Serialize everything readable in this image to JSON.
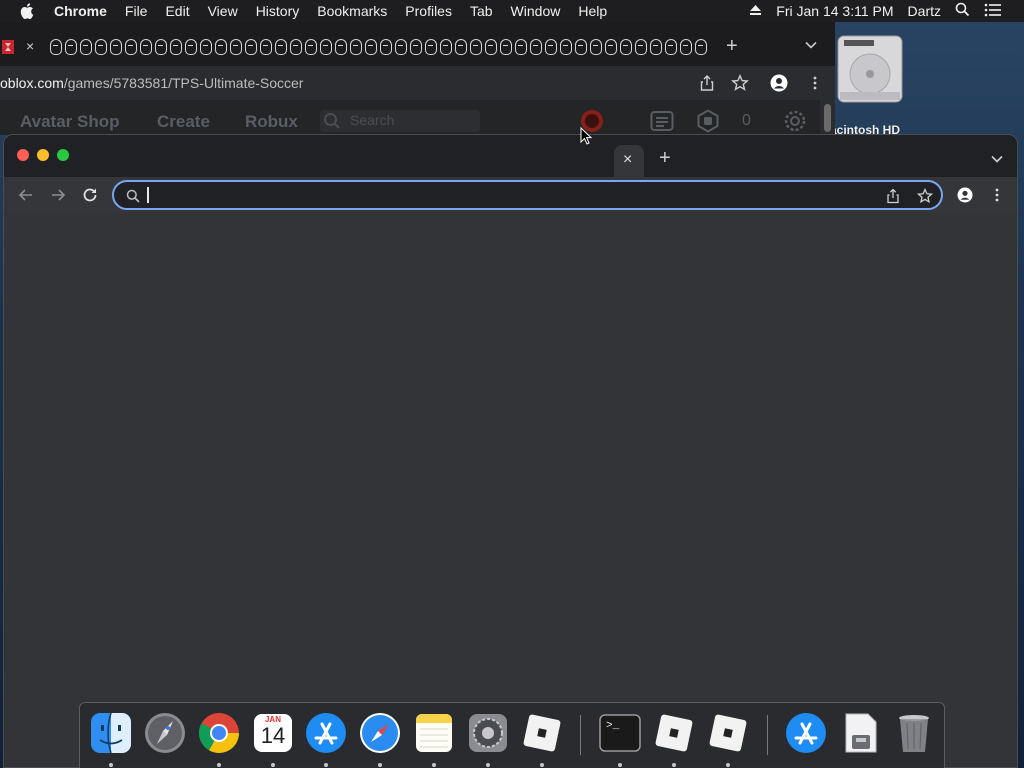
{
  "menubar": {
    "apple_icon": "apple-icon",
    "app_name": "Chrome",
    "menus": [
      "File",
      "Edit",
      "View",
      "History",
      "Bookmarks",
      "Profiles",
      "Tab",
      "Window",
      "Help"
    ],
    "eject_icon": "eject-icon",
    "datetime": "Fri Jan 14  3:11 PM",
    "user": "Dartz",
    "spotlight_icon": "search-icon",
    "control_center_icon": "list-icon"
  },
  "back_window": {
    "tab_close": "×",
    "new_tab": "+",
    "url_host": "oblox.com",
    "url_path": "/games/5783581/TPS-Ultimate-Soccer",
    "page_nav": [
      "Avatar Shop",
      "Create",
      "Robux"
    ],
    "search_placeholder": "Search",
    "robux_count": "0"
  },
  "desktop": {
    "hd_label": "acintosh HD"
  },
  "front_window": {
    "tab_close": "×",
    "new_tab": "+",
    "omnibox_value": "",
    "omnibox_placeholder": ""
  },
  "dock": {
    "items": [
      "Finder",
      "Launchpad",
      "Google Chrome",
      "Calendar",
      "App Store",
      "Safari",
      "Notes",
      "System Preferences",
      "Roblox",
      "Terminal",
      "Roblox",
      "Roblox",
      "App Store",
      "Archive Utility",
      "Trash"
    ],
    "calendar_month": "JAN",
    "calendar_day": "14",
    "terminal_prompt": ">_"
  },
  "colors": {
    "accent": "#7aa7f3",
    "traffic_red": "#fe5f57",
    "traffic_yellow": "#febc2e",
    "traffic_green": "#28c840",
    "roblox_red": "#e2231a"
  }
}
